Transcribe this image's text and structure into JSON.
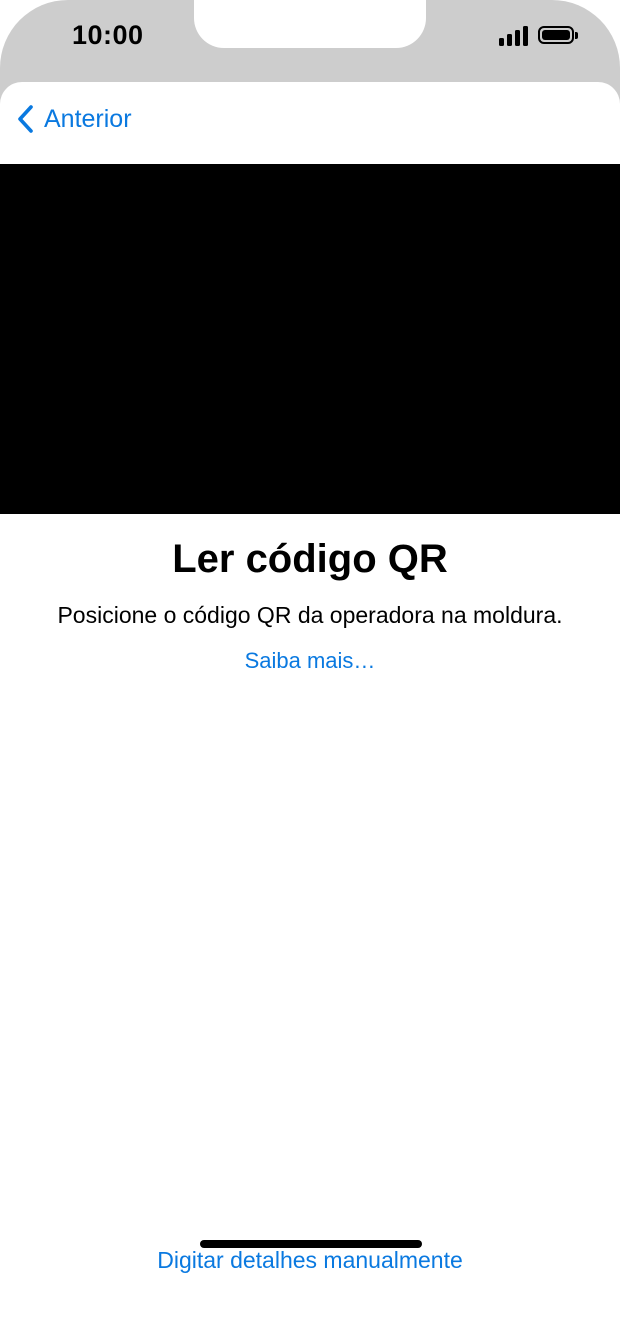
{
  "status_bar": {
    "time": "10:00",
    "signal_icon": "cellular-signal-icon",
    "battery_icon": "battery-full-icon"
  },
  "nav": {
    "back_label": "Anterior",
    "back_icon": "chevron-left-icon"
  },
  "content": {
    "title": "Ler código QR",
    "subtitle": "Posicione o código QR da operadora na moldura.",
    "learn_more": "Saiba mais…",
    "manual_entry": "Digitar detalhes manualmente"
  },
  "colors": {
    "accent": "#0a79e0",
    "camera_background": "#000000",
    "bezel": "#cdcdcd"
  }
}
